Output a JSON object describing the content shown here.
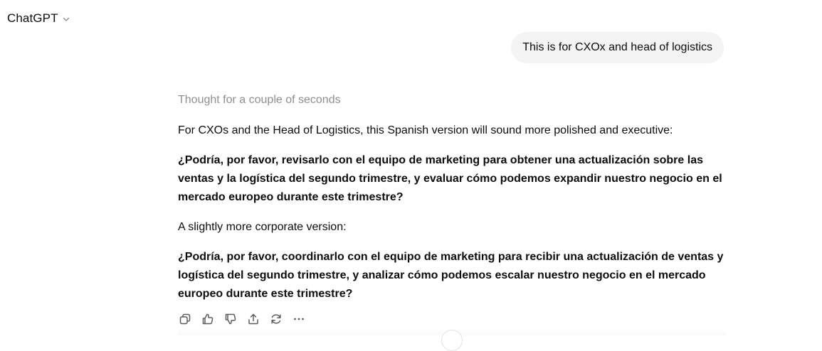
{
  "header": {
    "model_name": "ChatGPT",
    "chevron_icon": "chevron-down-icon"
  },
  "conversation": {
    "user_message": "This is for CXOx and head of logistics",
    "assistant": {
      "thought_status": "Thought for a couple of seconds",
      "intro": "For CXOs and the Head of Logistics, this Spanish version will sound more polished and executive:",
      "version_1": "¿Podría, por favor, revisarlo con el equipo de marketing para obtener una actualización sobre las ventas y la logística del segundo trimestre, y evaluar cómo podemos expandir nuestro negocio en el mercado europeo durante este trimestre?",
      "corporate_intro": "A slightly more corporate version:",
      "version_2": "¿Podría, por favor, coordinarlo con el equipo de marketing para recibir una actualización de ventas y logística del segundo trimestre, y analizar cómo podemos escalar nuestro negocio en el mercado europeo durante este trimestre?"
    }
  },
  "actions": [
    {
      "name": "copy-icon"
    },
    {
      "name": "thumbs-up-icon"
    },
    {
      "name": "thumbs-down-icon"
    },
    {
      "name": "share-icon"
    },
    {
      "name": "regenerate-icon"
    },
    {
      "name": "more-icon"
    }
  ],
  "colors": {
    "text": "#0d0d0d",
    "muted": "#8f8f8f",
    "bubble": "#f4f4f4",
    "icon": "#5d5d5d"
  }
}
